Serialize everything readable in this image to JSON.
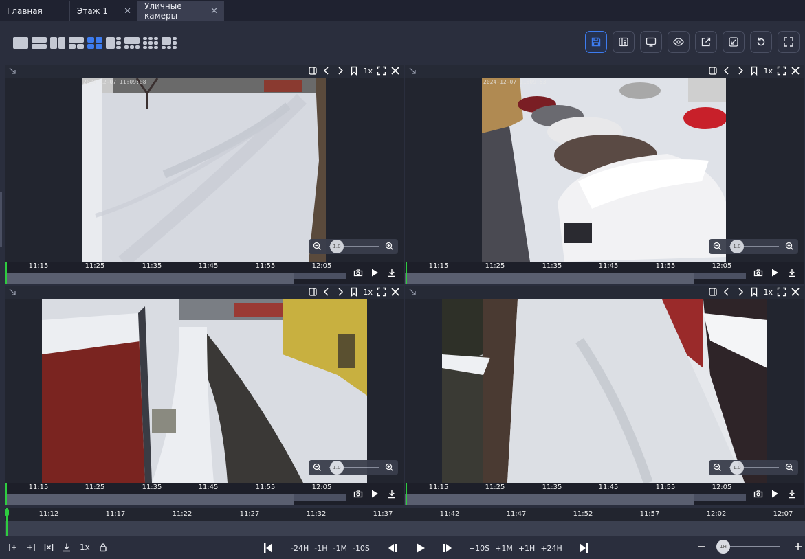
{
  "tabs": [
    {
      "label": "Главная",
      "closable": false
    },
    {
      "label": "Этаж 1",
      "closable": true
    },
    {
      "label": "Уличные камеры",
      "closable": true,
      "active": true
    }
  ],
  "tab_close_glyph": "✕",
  "toolbar": {
    "layouts": [
      "layout-1x1",
      "layout-2-rows",
      "layout-2-cols",
      "layout-1-plus-2",
      "layout-2x2",
      "layout-1-plus-3",
      "layout-1-plus-5",
      "layout-3x3",
      "layout-1-plus-7"
    ],
    "active_layout": "layout-2x2",
    "actions": [
      "save-icon",
      "layout-list-icon",
      "monitor-icon",
      "eye-icon",
      "export-icon",
      "resize-icon",
      "refresh-icon",
      "fullscreen-icon"
    ]
  },
  "cameras": [
    {
      "id": "cam1",
      "timestamp": "2024-12-07 11:09:08",
      "speed": "1x",
      "zoom": "1.0",
      "ticks": [
        "11:15",
        "11:25",
        "11:35",
        "11:45",
        "11:55",
        "12:05"
      ]
    },
    {
      "id": "cam2",
      "timestamp": "2024-12-07 11:09:53",
      "speed": "1x",
      "zoom": "1.0",
      "ticks": [
        "11:15",
        "11:25",
        "11:35",
        "11:45",
        "11:55",
        "12:05"
      ]
    },
    {
      "id": "cam3",
      "timestamp": "",
      "speed": "1x",
      "zoom": "1.0",
      "ticks": [
        "11:15",
        "11:25",
        "11:35",
        "11:45",
        "11:55",
        "12:05"
      ]
    },
    {
      "id": "cam4",
      "timestamp": "",
      "speed": "1x",
      "zoom": "1.0",
      "ticks": [
        "11:15",
        "11:25",
        "11:35",
        "11:45",
        "11:55",
        "12:05"
      ]
    }
  ],
  "main_timeline": {
    "ticks": [
      "11:12",
      "11:17",
      "11:22",
      "11:27",
      "11:32",
      "11:37",
      "11:42",
      "11:47",
      "11:52",
      "11:57",
      "12:02",
      "12:07"
    ]
  },
  "bottom": {
    "speed": "1x",
    "jumps_back": [
      "-24H",
      "-1H",
      "-1M",
      "-10S"
    ],
    "jumps_fwd": [
      "+10S",
      "+1M",
      "+1H",
      "+24H"
    ],
    "scale": "1H"
  },
  "colors": {
    "accent": "#3d7cf0",
    "cursor": "#2ecc40",
    "bg": "#2a2e3d"
  }
}
